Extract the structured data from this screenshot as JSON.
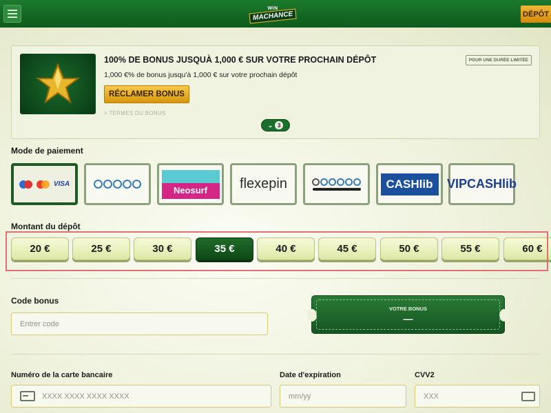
{
  "header": {
    "logo_top": "WIN",
    "logo_main": "MACHANCE",
    "deposit_label": "DÉPÔT"
  },
  "bonus": {
    "title": "100% DE BONUS JUSQUÀ 1,000 € SUR VOTRE PROCHAIN DÉPÔT",
    "description": "1,000 €% de bonus jusqu'à 1,000 € sur votre prochain dépôt",
    "claim_label": "RÉCLAMER BONUS",
    "terms_label": "> TERMES DU BONUS",
    "limited_label": "POUR UNE DURÉE LIMITÉE",
    "expand_count": "3"
  },
  "payment": {
    "section_label": "Mode de paiement",
    "methods": [
      {
        "id": "cards",
        "label": "VISA",
        "selected": true
      },
      {
        "id": "crypto",
        "label": "",
        "selected": false
      },
      {
        "id": "neosurf",
        "label": "Neosurf",
        "selected": false
      },
      {
        "id": "flexepin",
        "label": "flexepin",
        "selected": false
      },
      {
        "id": "crypto2",
        "label": "",
        "selected": false
      },
      {
        "id": "cashlib",
        "label": "CASHlib",
        "selected": false
      },
      {
        "id": "vipcashlib",
        "label": "VIPCASHlib",
        "selected": false
      }
    ]
  },
  "amount": {
    "section_label": "Montant du dépôt",
    "options": [
      "20 €",
      "25 €",
      "30 €",
      "35 €",
      "40 €",
      "45 €",
      "50 €",
      "55 €",
      "60 €"
    ],
    "selected": "35 €"
  },
  "bonus_code": {
    "label": "Code bonus",
    "placeholder": "Entrer code",
    "your_bonus_label": "VOTRE BONUS",
    "your_bonus_value": "—"
  },
  "card": {
    "number_label": "Numéro de la carte bancaire",
    "number_placeholder": "XXXX XXXX XXXX XXXX",
    "expiry_label": "Date d'expiration",
    "expiry_placeholder": "mm/yy",
    "cvv_label": "CVV2",
    "cvv_placeholder": "XXX"
  },
  "colors": {
    "brand_green": "#0e5a1c",
    "accent_gold": "#f0b637",
    "selected_amount": "#1f6b2a"
  }
}
